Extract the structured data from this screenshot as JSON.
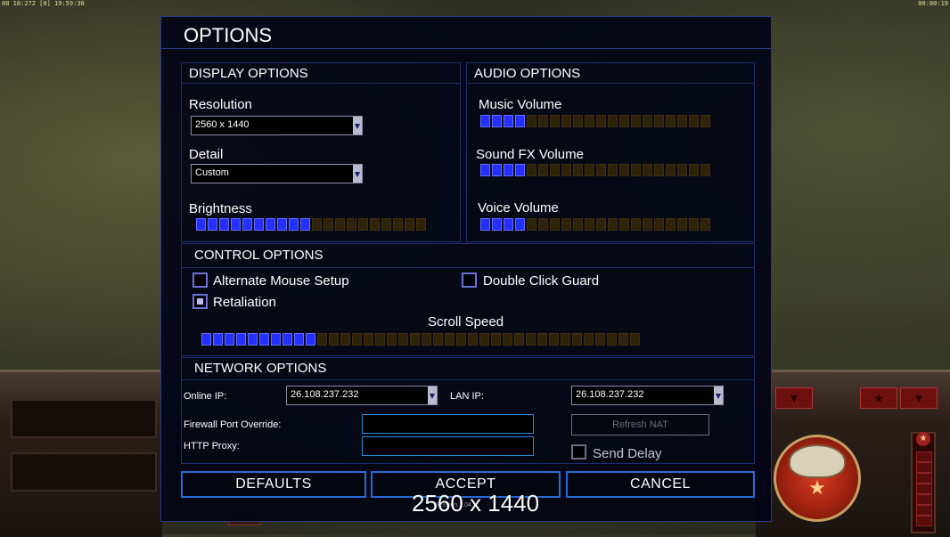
{
  "hud": {
    "top_left": "08 10:272 [0] 19:59:30",
    "top_right": "00:00:19"
  },
  "dialog": {
    "title": "OPTIONS"
  },
  "display": {
    "header": "DISPLAY OPTIONS",
    "resolution_label": "Resolution",
    "resolution_value": "2560 x 1440",
    "detail_label": "Detail",
    "detail_value": "Custom",
    "brightness_label": "Brightness",
    "brightness_level": 10,
    "brightness_segments": 20
  },
  "audio": {
    "header": "AUDIO OPTIONS",
    "music_label": "Music Volume",
    "music_level": 4,
    "sfx_label": "Sound FX Volume",
    "sfx_level": 4,
    "voice_label": "Voice Volume",
    "voice_level": 4,
    "segments": 20
  },
  "control": {
    "header": "CONTROL OPTIONS",
    "alt_mouse_label": "Alternate Mouse Setup",
    "alt_mouse_checked": false,
    "double_click_label": "Double Click Guard",
    "double_click_checked": false,
    "retaliation_label": "Retaliation",
    "retaliation_checked": true,
    "scroll_label": "Scroll Speed",
    "scroll_level": 10,
    "scroll_segments": 38
  },
  "network": {
    "header": "NETWORK OPTIONS",
    "online_ip_label": "Online IP:",
    "online_ip_value": "26.108.237.232",
    "lan_ip_label": "LAN IP:",
    "lan_ip_value": "26.108.237.232",
    "firewall_label": "Firewall Port Override:",
    "firewall_value": "",
    "http_proxy_label": "HTTP Proxy:",
    "http_proxy_value": "",
    "refresh_nat_label": "Refresh NAT",
    "send_delay_label": "Send Delay",
    "send_delay_checked": false
  },
  "buttons": {
    "defaults": "DEFAULTS",
    "accept": "ACCEPT",
    "cancel": "CANCEL"
  },
  "version": "Version 1.04",
  "resolution_overlay": "2560 x 1440",
  "colors": {
    "accent_blue": "#2430ff",
    "border_blue": "#2a6ad8",
    "segment_off": "#2e2308"
  }
}
